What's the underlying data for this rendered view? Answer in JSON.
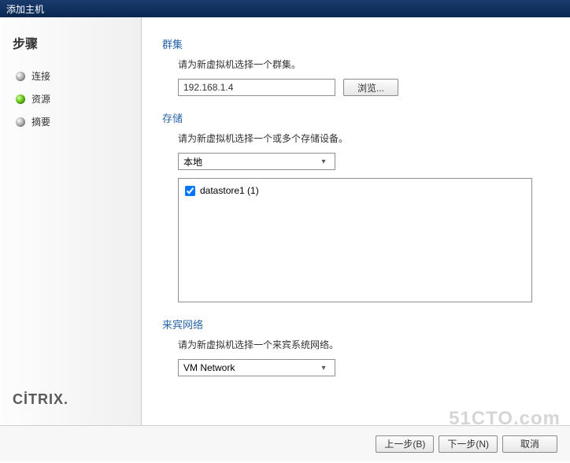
{
  "window": {
    "title": "添加主机"
  },
  "sidebar": {
    "heading": "步骤",
    "steps": [
      {
        "label": "连接",
        "active": false
      },
      {
        "label": "资源",
        "active": true
      },
      {
        "label": "摘要",
        "active": false
      }
    ],
    "brand": "CİTRIX"
  },
  "cluster": {
    "title": "群集",
    "desc": "请为新虚拟机选择一个群集。",
    "value": "192.168.1.4",
    "browse_label": "浏览..."
  },
  "storage": {
    "title": "存储",
    "desc": "请为新虚拟机选择一个或多个存储设备。",
    "selected": "本地",
    "items": [
      {
        "label": "datastore1 (1)",
        "checked": true
      }
    ]
  },
  "network": {
    "title": "来宾网络",
    "desc": "请为新虚拟机选择一个来宾系统网络。",
    "selected": "VM Network"
  },
  "footer": {
    "back": "上一步(B)",
    "next": "下一步(N)",
    "cancel": "取消"
  },
  "watermark": "51CTO.com"
}
